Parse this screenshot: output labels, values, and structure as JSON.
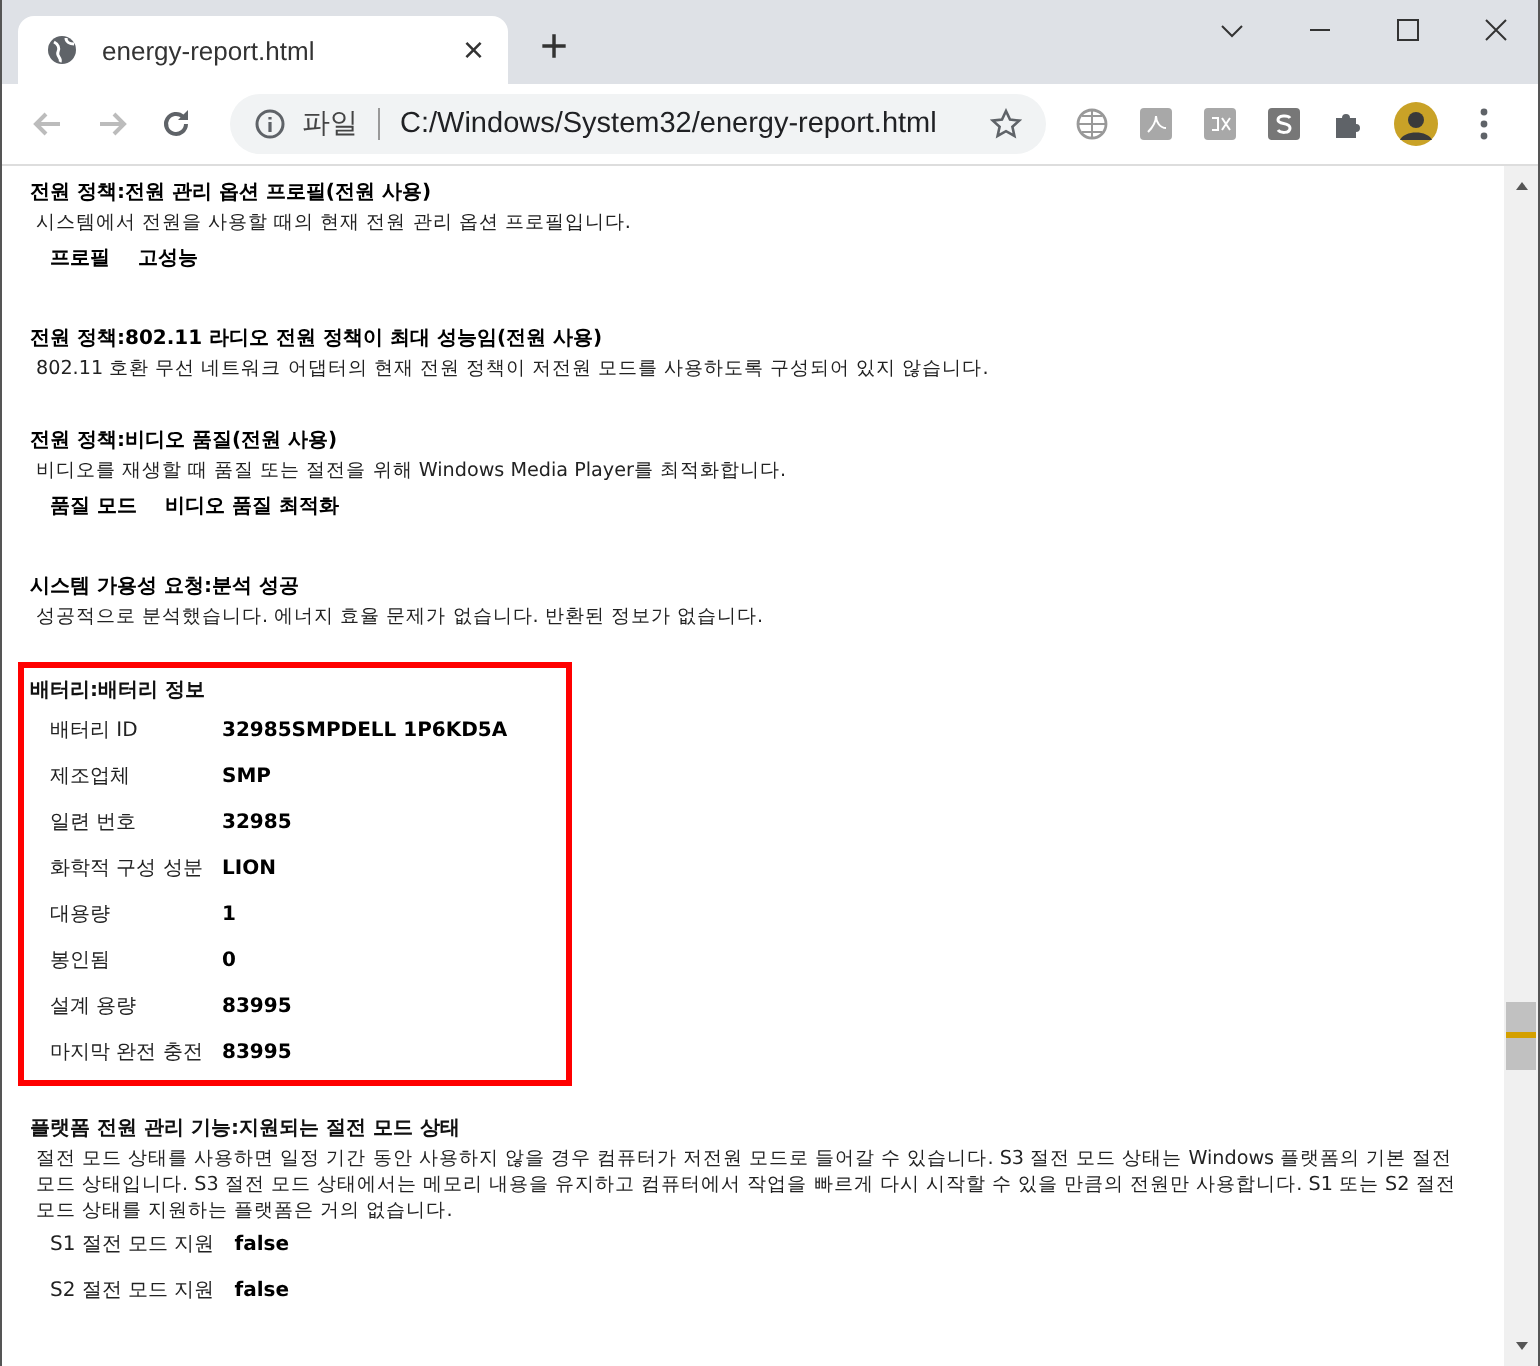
{
  "tab": {
    "title": "energy-report.html",
    "close": "×",
    "new_tab": "+"
  },
  "nav": {
    "back_disabled": true,
    "forward_disabled": true
  },
  "address": {
    "scheme_label": "파일",
    "url": "C:/Windows/System32/energy-report.html"
  },
  "sections": [
    {
      "kind": "policy",
      "highlighted": false,
      "title": "전원 정책:전원 관리 옵션 프로필(전원 사용)",
      "description": "시스템에서 전원을 사용할 때의 현재 전원 관리 옵션 프로필입니다.",
      "rows": [
        {
          "label": "프로필",
          "value": "고성능"
        }
      ]
    },
    {
      "kind": "policy",
      "highlighted": false,
      "title": "전원 정책:802.11 라디오 전원 정책이 최대 성능임(전원 사용)",
      "description": "802.11 호환 무선 네트워크 어댑터의 현재 전원 정책이 저전원 모드를 사용하도록 구성되어 있지 않습니다."
    },
    {
      "kind": "policy",
      "highlighted": false,
      "title": "전원 정책:비디오 품질(전원 사용)",
      "description": "비디오를 재생할 때 품질 또는 절전을 위해 Windows Media Player를 최적화합니다.",
      "rows": [
        {
          "label": "품질 모드",
          "value": "비디오 품질 최적화"
        }
      ]
    },
    {
      "kind": "policy",
      "highlighted": false,
      "title": "시스템 가용성 요청:분석 성공",
      "description": "성공적으로 분석했습니다. 에너지 효율 문제가 없습니다. 반환된 정보가 없습니다."
    },
    {
      "kind": "info",
      "highlighted": true,
      "title": "배터리:배터리 정보",
      "rows": [
        {
          "label": "배터리 ID",
          "value": "32985SMPDELL 1P6KD5A"
        },
        {
          "label": "제조업체",
          "value": "SMP"
        },
        {
          "label": "일련 번호",
          "value": "32985"
        },
        {
          "label": "화학적 구성 성분",
          "value": "LION"
        },
        {
          "label": "대용량",
          "value": "1"
        },
        {
          "label": "봉인됨",
          "value": "0"
        },
        {
          "label": "설계 용량",
          "value": "83995"
        },
        {
          "label": "마지막 완전 충전",
          "value": "83995"
        }
      ]
    },
    {
      "kind": "info",
      "highlighted": false,
      "title": "플랫폼 전원 관리 기능:지원되는 절전 모드 상태",
      "description": "절전 모드 상태를 사용하면 일정 기간 동안 사용하지 않을 경우 컴퓨터가 저전원 모드로 들어갈 수 있습니다. S3 절전 모드 상태는 Windows 플랫폼의 기본 절전 모드 상태입니다. S3 절전 모드 상태에서는 메모리 내용을 유지하고 컴퓨터에서 작업을 빠르게 다시 시작할 수 있을 만큼의 전원만 사용합니다. S1 또는 S2 절전 모드 상태를 지원하는 플랫폼은 거의 없습니다.",
      "rows": [
        {
          "label": "S1 절전 모드 지원",
          "value": "false"
        },
        {
          "label": "S2 절전 모드 지원",
          "value": "false"
        }
      ]
    }
  ]
}
